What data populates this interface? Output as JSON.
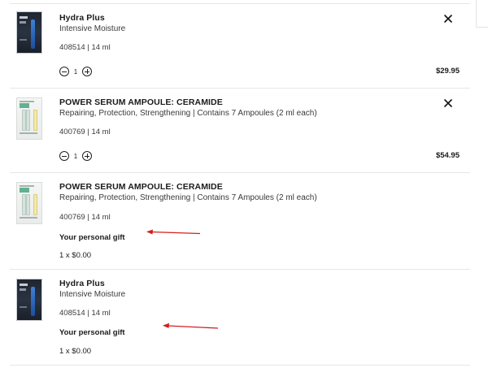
{
  "cart": {
    "items": [
      {
        "title": "Hydra Plus",
        "subtitle": "Intensive Moisture",
        "meta": "408514 | 14 ml",
        "quantity": "1",
        "price": "$29.95",
        "thumbnail": "dark-ampoule-box"
      },
      {
        "title": "POWER SERUM AMPOULE: CERAMIDE",
        "subtitle": "Repairing, Protection, Strengthening | Contains 7 Ampoules (2 ml each)",
        "meta": "400769 | 14 ml",
        "quantity": "1",
        "price": "$54.95",
        "thumbnail": "light-ampoule-box"
      },
      {
        "title": "POWER SERUM AMPOULE: CERAMIDE",
        "subtitle": "Repairing, Protection, Strengthening | Contains 7 Ampoules (2 ml each)",
        "meta": "400769 | 14 ml",
        "gift_label": "Your personal gift",
        "gift_qty": "1 x $0.00",
        "thumbnail": "light-ampoule-box"
      },
      {
        "title": "Hydra Plus",
        "subtitle": "Intensive Moisture",
        "meta": "408514 | 14 ml",
        "gift_label": "Your personal gift",
        "gift_qty": "1 x $0.00",
        "thumbnail": "dark-ampoule-box"
      }
    ]
  },
  "icons": {
    "remove": "close-icon",
    "decrease": "minus-circle-icon",
    "increase": "plus-circle-icon",
    "annotation": "red-arrow-icon"
  },
  "colors": {
    "annotation_arrow": "#d11f1f",
    "divider": "#e6e6e6",
    "text": "#1b1b1b"
  }
}
